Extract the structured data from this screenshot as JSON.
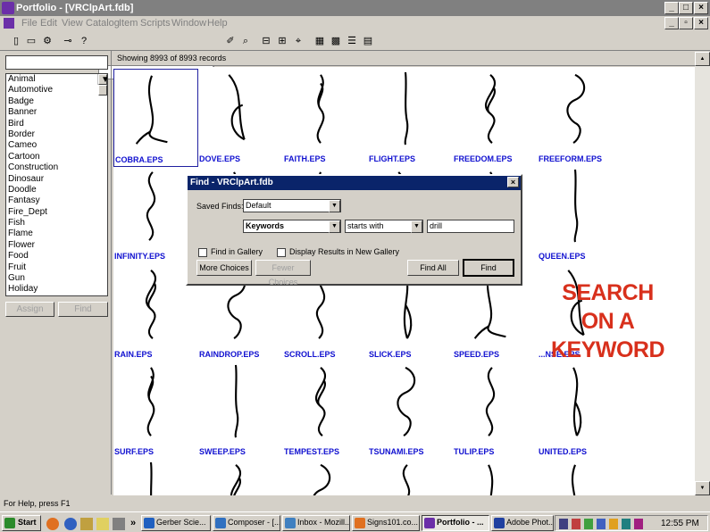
{
  "window": {
    "title": "Portfolio - [VRClpArt.fdb]"
  },
  "menu": [
    "File",
    "Edit",
    "View",
    "Catalog",
    "Item",
    "Scripts",
    "Window",
    "Help"
  ],
  "header": {
    "records": "Showing 8993 of 8993 records"
  },
  "sidebar": {
    "categories": [
      "Animal",
      "Automotive",
      "Badge",
      "Banner",
      "Bird",
      "Border",
      "Cameo",
      "Cartoon",
      "Construction",
      "Dinosaur",
      "Doodle",
      "Fantasy",
      "Fire_Dept",
      "Fish",
      "Flame",
      "Flower",
      "Food",
      "Fruit",
      "Gun",
      "Holiday"
    ],
    "assign_label": "Assign",
    "find_label": "Find"
  },
  "gallery": [
    "COBRA.EPS",
    "DOVE.EPS",
    "FAITH.EPS",
    "FLIGHT.EPS",
    "FREEDOM.EPS",
    "FREEFORM.EPS",
    "INFINITY.EPS",
    "",
    "",
    "",
    "",
    "QUEEN.EPS",
    "RAIN.EPS",
    "RAINDROP.EPS",
    "SCROLL.EPS",
    "SLICK.EPS",
    "SPEED.EPS",
    "...NSE.EPS",
    "SURF.EPS",
    "SWEEP.EPS",
    "TEMPEST.EPS",
    "TSUNAMI.EPS",
    "TULIP.EPS",
    "UNITED.EPS"
  ],
  "overlay": {
    "line1": "SEARCH",
    "line2": "ON A",
    "line3": "KEYWORD"
  },
  "find_dialog": {
    "title": "Find - VRClpArt.fdb",
    "saved_finds_label": "Saved Finds:",
    "saved_finds_value": "Default",
    "field_value": "Keywords",
    "operator_value": "starts with",
    "term_value": "drill",
    "find_in_gallery": "Find in Gallery",
    "display_new_gallery": "Display Results in New Gallery",
    "more_choices": "More Choices",
    "fewer_choices": "Fewer Choices",
    "find_all": "Find All",
    "find": "Find"
  },
  "status": {
    "help": "For Help, press F1"
  },
  "taskbar": {
    "start": "Start",
    "chevron": "»",
    "tasks": [
      "Gerber Scie...",
      "Composer - [...",
      "Inbox - Mozill...",
      "Signs101.co...",
      "Portfolio - ...",
      "Adobe Phot..."
    ],
    "clock": "12:55 PM"
  },
  "colors": {
    "accent": "#0a246a",
    "overlay": "#d8301c",
    "link": "#1010d0"
  }
}
